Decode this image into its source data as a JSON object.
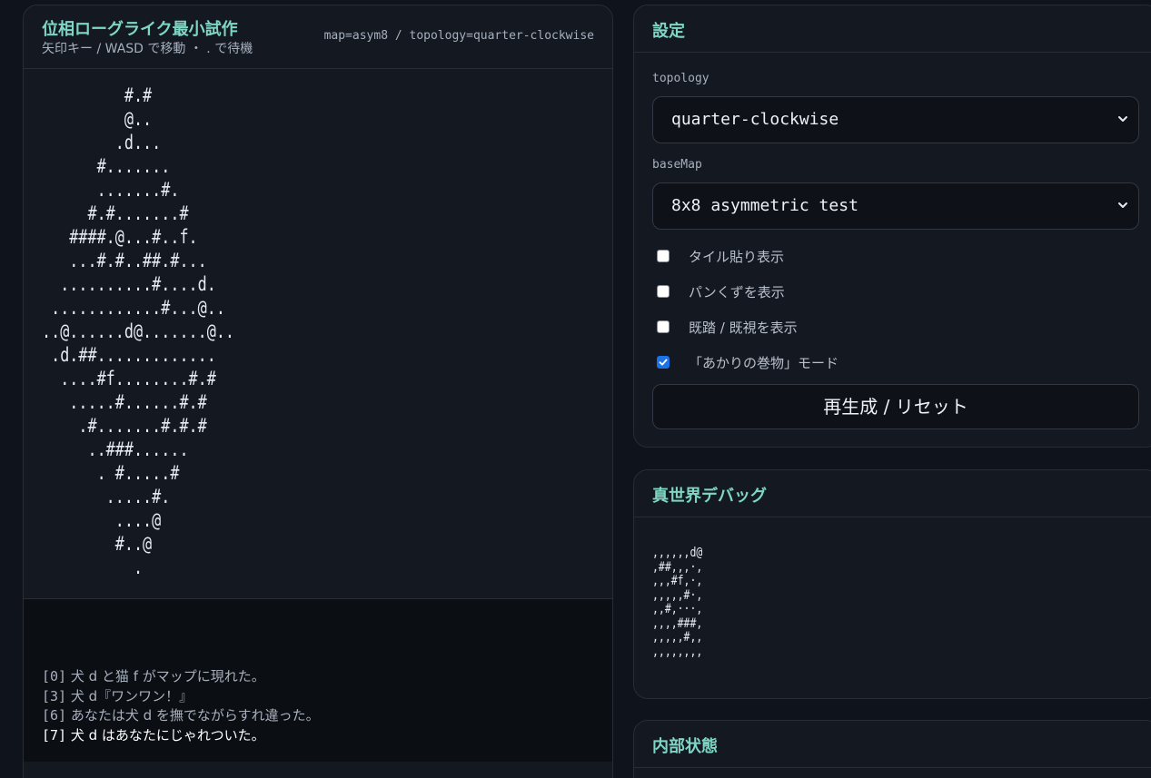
{
  "game": {
    "title": "位相ローグライク最小試作",
    "subtitle": "矢印キー / WASD で移動  ・ . で待機",
    "map_info": "map=asym8 / topology=quarter-clockwise",
    "map_lines": "         #.#\n         @..\n        .d...\n      #.......\n      .......#.\n     #.#.......#\n   ####.@...#..f.\n   ...#.#..##.#...\n  ..........#....d.\n ............#...@..\n..@......d@.......@..\n .d.##.............\n  ....#f........#.#\n   .....#......#.#\n    .#.......#.#.#\n     ..###......\n      . #.....#\n       .....#.\n        ....@\n        #..@\n          .",
    "log": [
      {
        "idx": "[0]",
        "text": " 犬 d と猫 f がマップに現れた。"
      },
      {
        "idx": "[3]",
        "text": " 犬 d『ワンワン！』"
      },
      {
        "idx": "[6]",
        "text": " あなたは犬 d を撫でながらすれ違った。"
      },
      {
        "idx": "[7]",
        "text": " 犬 d はあなたにじゃれついた。"
      }
    ]
  },
  "settings": {
    "title": "設定",
    "topology_label": "topology",
    "topology_value": "quarter-clockwise",
    "basemap_label": "baseMap",
    "basemap_value": "8x8 asymmetric test",
    "checks": [
      {
        "label": "タイル貼り表示",
        "checked": false
      },
      {
        "label": "パンくずを表示",
        "checked": false
      },
      {
        "label": "既踏 / 既視を表示",
        "checked": false
      },
      {
        "label": "「あかりの巻物」モード",
        "checked": true
      }
    ],
    "reset_label": "再生成 / リセット"
  },
  "debug": {
    "title": "真世界デバッグ",
    "grid": ",,,,,,d@\n,##,,,·,\n,,,#f,·,\n,,,,,#·,\n,,#,···,\n,,,,###,\n,,,,,#,,\n,,,,,,,,"
  },
  "state": {
    "title": "内部状態"
  },
  "colors": {
    "accent": "#7fd6c4",
    "background": "#0f131b",
    "panel": "#131821",
    "checkbox_checked": "#1a73e8"
  }
}
